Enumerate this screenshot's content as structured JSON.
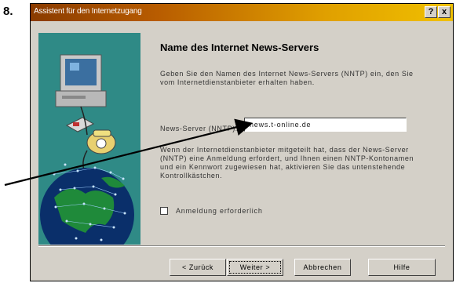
{
  "step_number": "8.",
  "window": {
    "title": "Assistent für den Internetzugang",
    "help_button": "?",
    "close_button": "x"
  },
  "page": {
    "heading": "Name des Internet News-Servers",
    "intro": "Geben Sie den Namen des Internet News-Servers (NNTP) ein, den Sie vom Internetdienstanbieter erhalten haben.",
    "field_label": "News-Server (NNTP):",
    "field_value": "news.t-online.de",
    "note": "Wenn der Internetdienstanbieter mitgeteilt hat, dass der News-Server (NNTP) eine Anmeldung erfordert, und Ihnen einen NNTP-Kontonamen und ein Kennwort zugewiesen hat, aktivieren Sie das untenstehende Kontrollkästchen.",
    "checkbox_label": "Anmeldung erforderlich"
  },
  "buttons": {
    "back": "< Zurück",
    "next": "Weiter >",
    "cancel": "Abbrechen",
    "help": "Hilfe"
  }
}
